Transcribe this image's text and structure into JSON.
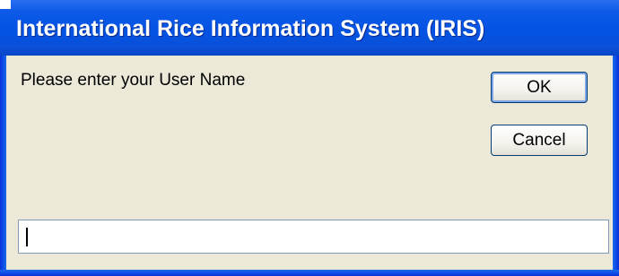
{
  "window": {
    "title": "International Rice Information System (IRIS)"
  },
  "dialog": {
    "prompt": "Please enter your User Name",
    "ok_label": "OK",
    "cancel_label": "Cancel",
    "username_value": "",
    "username_placeholder": ""
  },
  "colors": {
    "titlebar": "#0353e3",
    "dialog_background": "#ece9d8",
    "button_border": "#003c74",
    "input_border": "#7f9db9"
  }
}
